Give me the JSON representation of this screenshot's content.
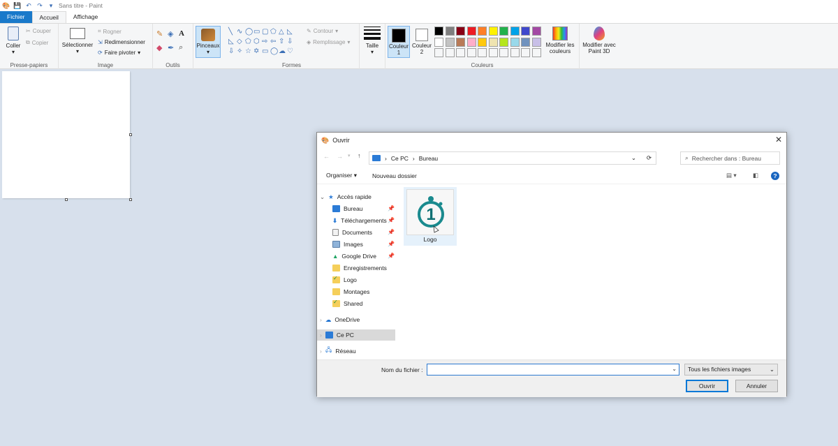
{
  "window": {
    "title": "Sans titre - Paint"
  },
  "tabs": [
    "Fichier",
    "Accueil",
    "Affichage"
  ],
  "ribbon": {
    "clipboard": {
      "label": "Presse-papiers",
      "paste": "Coller",
      "cut": "Couper",
      "copy": "Copier"
    },
    "image": {
      "label": "Image",
      "select": "Sélectionner",
      "crop": "Rogner",
      "resize": "Redimensionner",
      "rotate": "Faire pivoter"
    },
    "tools": {
      "label": "Outils"
    },
    "brushes": {
      "label": "Pinceaux"
    },
    "shapes": {
      "label": "Formes",
      "outline": "Contour",
      "fill": "Remplissage"
    },
    "size": {
      "label": "Taille"
    },
    "color1": {
      "label": "Couleur 1"
    },
    "color2": {
      "label": "Couleur 2"
    },
    "colors": {
      "label": "Couleurs",
      "edit": "Modifier les couleurs"
    },
    "paint3d": {
      "label": "Modifier avec Paint 3D"
    },
    "palette": [
      "#000000",
      "#7f7f7f",
      "#880015",
      "#ed1c24",
      "#ff7f27",
      "#fff200",
      "#22b14c",
      "#00a2e8",
      "#3f48cc",
      "#a349a4",
      "#ffffff",
      "#c3c3c3",
      "#b97a57",
      "#ffaec9",
      "#ffc90e",
      "#efe4b0",
      "#b5e61d",
      "#99d9ea",
      "#7092be",
      "#c8bfe7"
    ]
  },
  "dialog": {
    "title": "Ouvrir",
    "breadcrumb": [
      "Ce PC",
      "Bureau"
    ],
    "search_placeholder": "Rechercher dans : Bureau",
    "organize": "Organiser",
    "new_folder": "Nouveau dossier",
    "nav": {
      "quick_access": "Accès rapide",
      "items": [
        "Bureau",
        "Téléchargements",
        "Documents",
        "Images",
        "Google Drive",
        "Enregistrements",
        "Logo",
        "Montages",
        "Shared"
      ],
      "onedrive": "OneDrive",
      "this_pc": "Ce PC",
      "network": "Réseau"
    },
    "file": {
      "name": "Logo",
      "glyph": "1"
    },
    "filename_label": "Nom du fichier :",
    "filename_value": "",
    "filetype": "Tous les fichiers images",
    "open": "Ouvrir",
    "cancel": "Annuler"
  },
  "colors": {
    "accent": "#1979ca",
    "logo_teal": "#1a8a8e",
    "folder": "#f0c040"
  }
}
